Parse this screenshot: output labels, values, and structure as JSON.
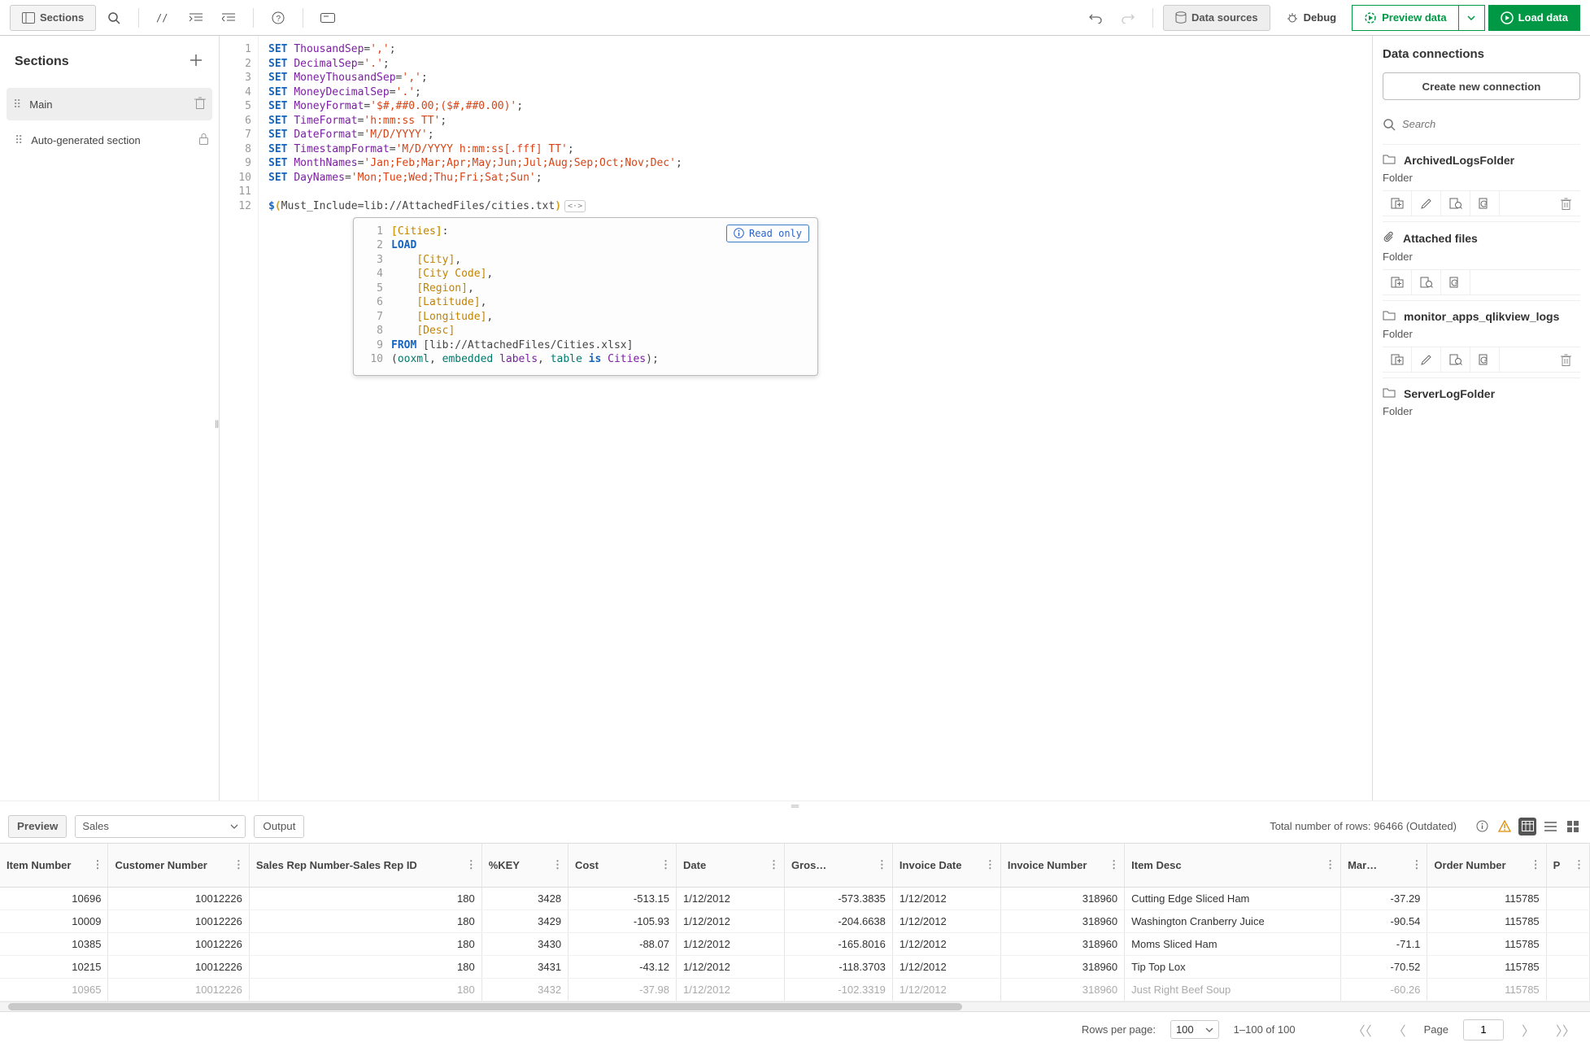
{
  "toolbar": {
    "sections_label": "Sections",
    "data_sources_label": "Data sources",
    "debug_label": "Debug",
    "preview_label": "Preview data",
    "load_label": "Load data"
  },
  "sidebar": {
    "title": "Sections",
    "items": [
      {
        "label": "Main",
        "active": true
      },
      {
        "label": "Auto-generated section",
        "locked": true
      }
    ]
  },
  "editor": {
    "lines": [
      "SET ThousandSep=',';",
      "SET DecimalSep='.';",
      "SET MoneyThousandSep=',';",
      "SET MoneyDecimalSep='.';",
      "SET MoneyFormat='$#,##0.00;($#,##0.00)';",
      "SET TimeFormat='h:mm:ss TT';",
      "SET DateFormat='M/D/YYYY';",
      "SET TimestampFormat='M/D/YYYY h:mm:ss[.fff] TT';",
      "SET MonthNames='Jan;Feb;Mar;Apr;May;Jun;Jul;Aug;Sep;Oct;Nov;Dec';",
      "SET DayNames='Mon;Tue;Wed;Thu;Fri;Sat;Sun';",
      "",
      "$(Must_Include=lib://AttachedFiles/cities.txt)"
    ],
    "vars": [
      "ThousandSep",
      "DecimalSep",
      "MoneyThousandSep",
      "MoneyDecimalSep",
      "MoneyFormat",
      "TimeFormat",
      "DateFormat",
      "TimestampFormat",
      "MonthNames",
      "DayNames"
    ],
    "vals": [
      "','",
      "'.'",
      "','",
      "'.'",
      "'$#,##0.00;($#,##0.00)'",
      "'h:mm:ss TT'",
      "'M/D/YYYY'",
      "'M/D/YYYY h:mm:ss[.fff] TT'",
      "'Jan;Feb;Mar;Apr;May;Jun;Jul;Aug;Sep;Oct;Nov;Dec'",
      "'Mon;Tue;Wed;Thu;Fri;Sat;Sun'"
    ],
    "include_inner": "Must_Include=lib://AttachedFiles/cities.txt"
  },
  "readonly": {
    "badge": "Read only",
    "table": "Cities",
    "fields": [
      "City",
      "City Code",
      "Region",
      "Latitude",
      "Longitude",
      "Desc"
    ],
    "from": "[lib://AttachedFiles/Cities.xlsx]",
    "opts_ooxml": "ooxml",
    "opts_embedded": "embedded",
    "opts_labels": "labels",
    "opts_table": "table",
    "opts_is": "is",
    "opts_cities": "Cities"
  },
  "connections": {
    "title": "Data connections",
    "create_label": "Create new connection",
    "search_placeholder": "Search",
    "items": [
      {
        "title": "ArchivedLogsFolder",
        "type": "Folder",
        "icon": "folder",
        "actions": [
          "insert",
          "edit",
          "select",
          "refresh",
          "delete"
        ]
      },
      {
        "title": "Attached files",
        "type": "Folder",
        "icon": "attach",
        "actions": [
          "insert",
          "select",
          "refresh"
        ]
      },
      {
        "title": "monitor_apps_qlikview_logs",
        "type": "Folder",
        "icon": "folder",
        "actions": [
          "insert",
          "edit",
          "select",
          "refresh",
          "delete"
        ]
      },
      {
        "title": "ServerLogFolder",
        "type": "Folder",
        "icon": "folder"
      }
    ]
  },
  "preview": {
    "preview_btn": "Preview",
    "table_selected": "Sales",
    "output_btn": "Output",
    "status_prefix": "Total number of rows: ",
    "status_count": "96466",
    "status_suffix": " (Outdated)"
  },
  "table": {
    "columns": [
      "Item Number",
      "Customer Number",
      "Sales Rep Number-Sales Rep ID",
      "%KEY",
      "Cost",
      "Date",
      "Gros…",
      "Invoice Date",
      "Invoice Number",
      "Item Desc",
      "Mar…",
      "Order Number",
      "P"
    ],
    "rows": [
      [
        "10696",
        "10012226",
        "180",
        "3428",
        "-513.15",
        "1/12/2012",
        "-573.3835",
        "1/12/2012",
        "318960",
        "Cutting Edge Sliced Ham",
        "-37.29",
        "115785"
      ],
      [
        "10009",
        "10012226",
        "180",
        "3429",
        "-105.93",
        "1/12/2012",
        "-204.6638",
        "1/12/2012",
        "318960",
        "Washington Cranberry Juice",
        "-90.54",
        "115785"
      ],
      [
        "10385",
        "10012226",
        "180",
        "3430",
        "-88.07",
        "1/12/2012",
        "-165.8016",
        "1/12/2012",
        "318960",
        "Moms Sliced Ham",
        "-71.1",
        "115785"
      ],
      [
        "10215",
        "10012226",
        "180",
        "3431",
        "-43.12",
        "1/12/2012",
        "-118.3703",
        "1/12/2012",
        "318960",
        "Tip Top Lox",
        "-70.52",
        "115785"
      ],
      [
        "10965",
        "10012226",
        "180",
        "3432",
        "-37.98",
        "1/12/2012",
        "-102.3319",
        "1/12/2012",
        "318960",
        "Just Right Beef Soup",
        "-60.26",
        "115785"
      ]
    ]
  },
  "pager": {
    "rows_per_page_label": "Rows per page:",
    "rows_per_page_value": "100",
    "range": "1–100 of 100",
    "page_label": "Page",
    "page_value": "1"
  }
}
